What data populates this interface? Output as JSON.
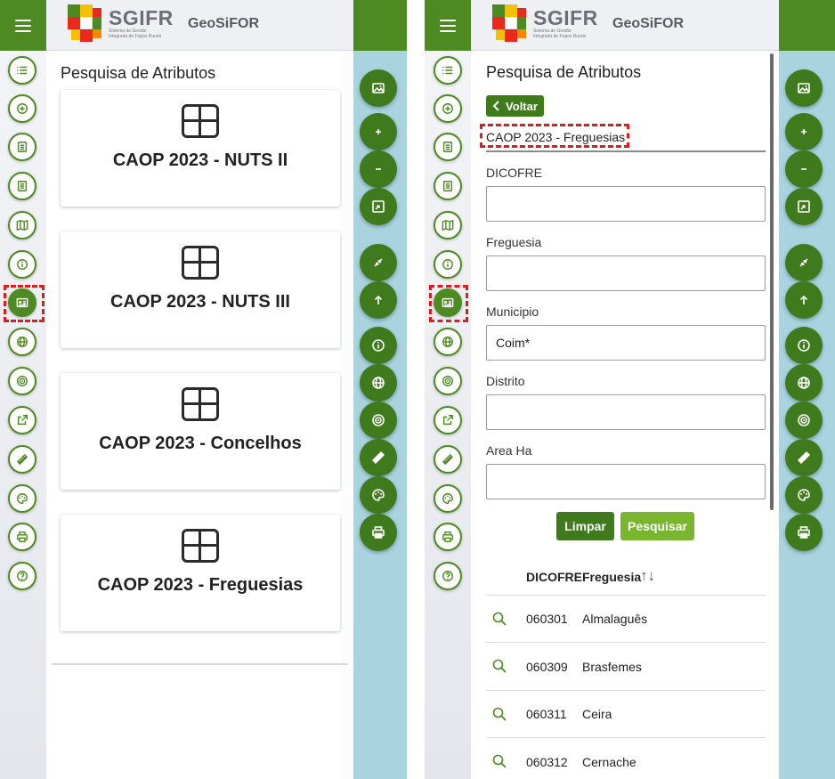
{
  "app": {
    "brand": "SGIFR",
    "brand_subtitle": "Sistema de Gestão Integrada de Fogos Rurais",
    "app_name": "GeoSiFOR"
  },
  "colors": {
    "primary_green": "#4e8a22",
    "dark_green": "#3f7a1c",
    "light_green": "#7ab530",
    "map_blue": "#a9d3df",
    "highlight_red": "#e01b1b"
  },
  "rail_icons": [
    "list-icon",
    "plus-circle-icon",
    "document-icon",
    "document-alt-icon",
    "map-icon",
    "info-icon",
    "id-card-icon",
    "globe-icon",
    "target-icon",
    "external-link-icon",
    "ruler-icon",
    "palette-icon",
    "printer-icon",
    "help-icon"
  ],
  "map_icons": [
    "image-icon",
    "zoom-in-icon",
    "zoom-out-icon",
    "fit-extent-icon",
    "collapse-icon",
    "upload-icon",
    "info-icon",
    "globe-icon",
    "target-icon",
    "ruler-icon",
    "palette-icon",
    "printer-icon"
  ],
  "left": {
    "title": "Pesquisa de Atributos",
    "cards": [
      {
        "label": "CAOP 2023 - NUTS II"
      },
      {
        "label": "CAOP 2023 - NUTS III"
      },
      {
        "label": "CAOP 2023 - Concelhos"
      },
      {
        "label": "CAOP 2023 - Freguesias"
      }
    ]
  },
  "right": {
    "title": "Pesquisa de Atributos",
    "back_label": "Voltar",
    "layer_name": "CAOP 2023 - Freguesias",
    "fields": [
      {
        "label": "DICOFRE",
        "value": ""
      },
      {
        "label": "Freguesia",
        "value": ""
      },
      {
        "label": "Municipio",
        "value": "Coim*"
      },
      {
        "label": "Distrito",
        "value": ""
      },
      {
        "label": "Area Ha",
        "value": ""
      }
    ],
    "clear_label": "Limpar",
    "search_label": "Pesquisar",
    "table": {
      "headers": [
        "DICOFRE",
        "Freguesia"
      ],
      "sort_glyph": "↑↓",
      "rows": [
        {
          "dicofre": "060301",
          "freguesia": "Almalaguês"
        },
        {
          "dicofre": "060309",
          "freguesia": "Brasfemes"
        },
        {
          "dicofre": "060311",
          "freguesia": "Ceira"
        },
        {
          "dicofre": "060312",
          "freguesia": "Cernache"
        }
      ]
    }
  }
}
